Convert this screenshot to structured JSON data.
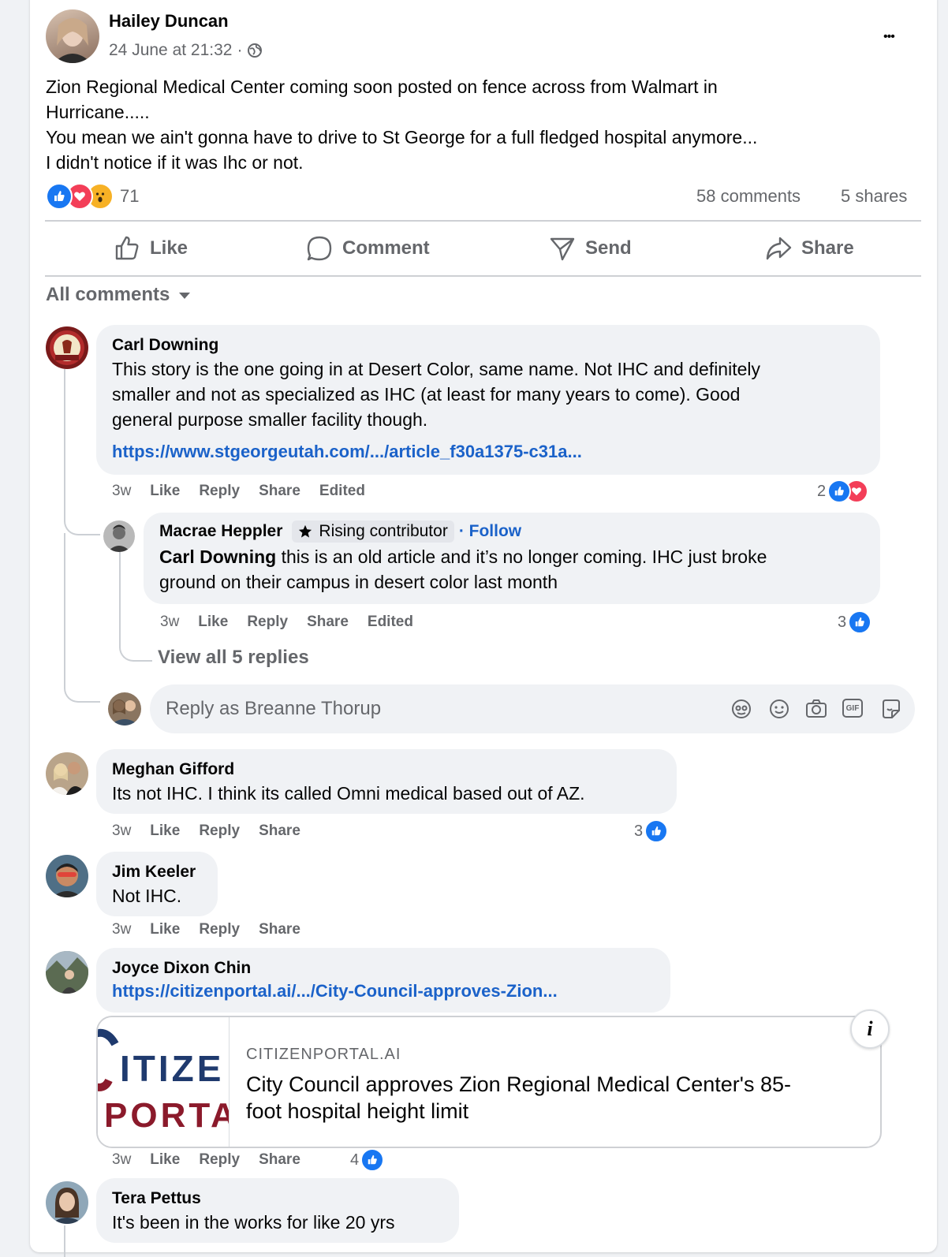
{
  "post": {
    "author": "Hailey Duncan",
    "timestamp": "24 June at 21:32",
    "separator": "·",
    "text_lines": [
      "Zion Regional Medical Center coming soon posted on fence across from Walmart in",
      "Hurricane.....",
      "You mean we ain't gonna have to drive to St George for a full fledged hospital anymore...",
      "I didn't notice if it was Ihc or not."
    ],
    "reaction_count": "71",
    "comments_count": "58 comments",
    "shares_count": "5 shares",
    "more_glyph": "•••"
  },
  "action_bar": {
    "like": "Like",
    "comment": "Comment",
    "send": "Send",
    "share": "Share"
  },
  "filter": {
    "label": "All comments"
  },
  "comment_actions": {
    "like": "Like",
    "reply": "Reply",
    "share": "Share",
    "edited": "Edited"
  },
  "comments": [
    {
      "author": "Carl Downing",
      "lines": [
        "This story is the one going in at Desert Color, same name. Not IHC and definitely",
        "smaller and not as specialized as IHC (at least for many years to come). Good",
        "general purpose smaller facility though."
      ],
      "link": "https://www.stgeorgeutah.com/.../article_f30a1375-c31a...",
      "time": "3w",
      "reactions": "2"
    },
    {
      "author": "Meghan Gifford",
      "text": "Its not IHC. I think its called Omni medical based out of AZ.",
      "time": "3w",
      "reactions": "3"
    },
    {
      "author": "Jim Keeler",
      "text": "Not IHC.",
      "time": "3w"
    },
    {
      "author": "Joyce Dixon Chin",
      "link": "https://citizenportal.ai/.../City-Council-approves-Zion...",
      "time": "3w",
      "reactions": "4",
      "preview": {
        "domain": "CITIZENPORTAL.AI",
        "title_lines": [
          "City Council approves Zion Regional Medical Center's 85-",
          "foot hospital height limit"
        ],
        "logo_top": "ITIZE",
        "logo_bottom": "PORTA",
        "info": "i"
      }
    },
    {
      "author": "Tera Pettus",
      "text": "It's been in the works for like 20 yrs"
    }
  ],
  "reply": {
    "author": "Macrae Heppler",
    "badge": "Rising contributor",
    "follow": "· Follow",
    "mention": "Carl Downing",
    "lines": [
      " this is an old article and it’s no longer coming. IHC just broke",
      "ground on their campus in desert color last month"
    ],
    "time": "3w",
    "reactions": "3"
  },
  "view_replies": "View all 5 replies",
  "reply_box": {
    "placeholder": "Reply as Breanne Thorup",
    "gif": "GIF"
  },
  "colors": {
    "link": "#1b62c9",
    "like": "#1877f2",
    "love": "#f33e58",
    "wow": "#f7b125"
  }
}
